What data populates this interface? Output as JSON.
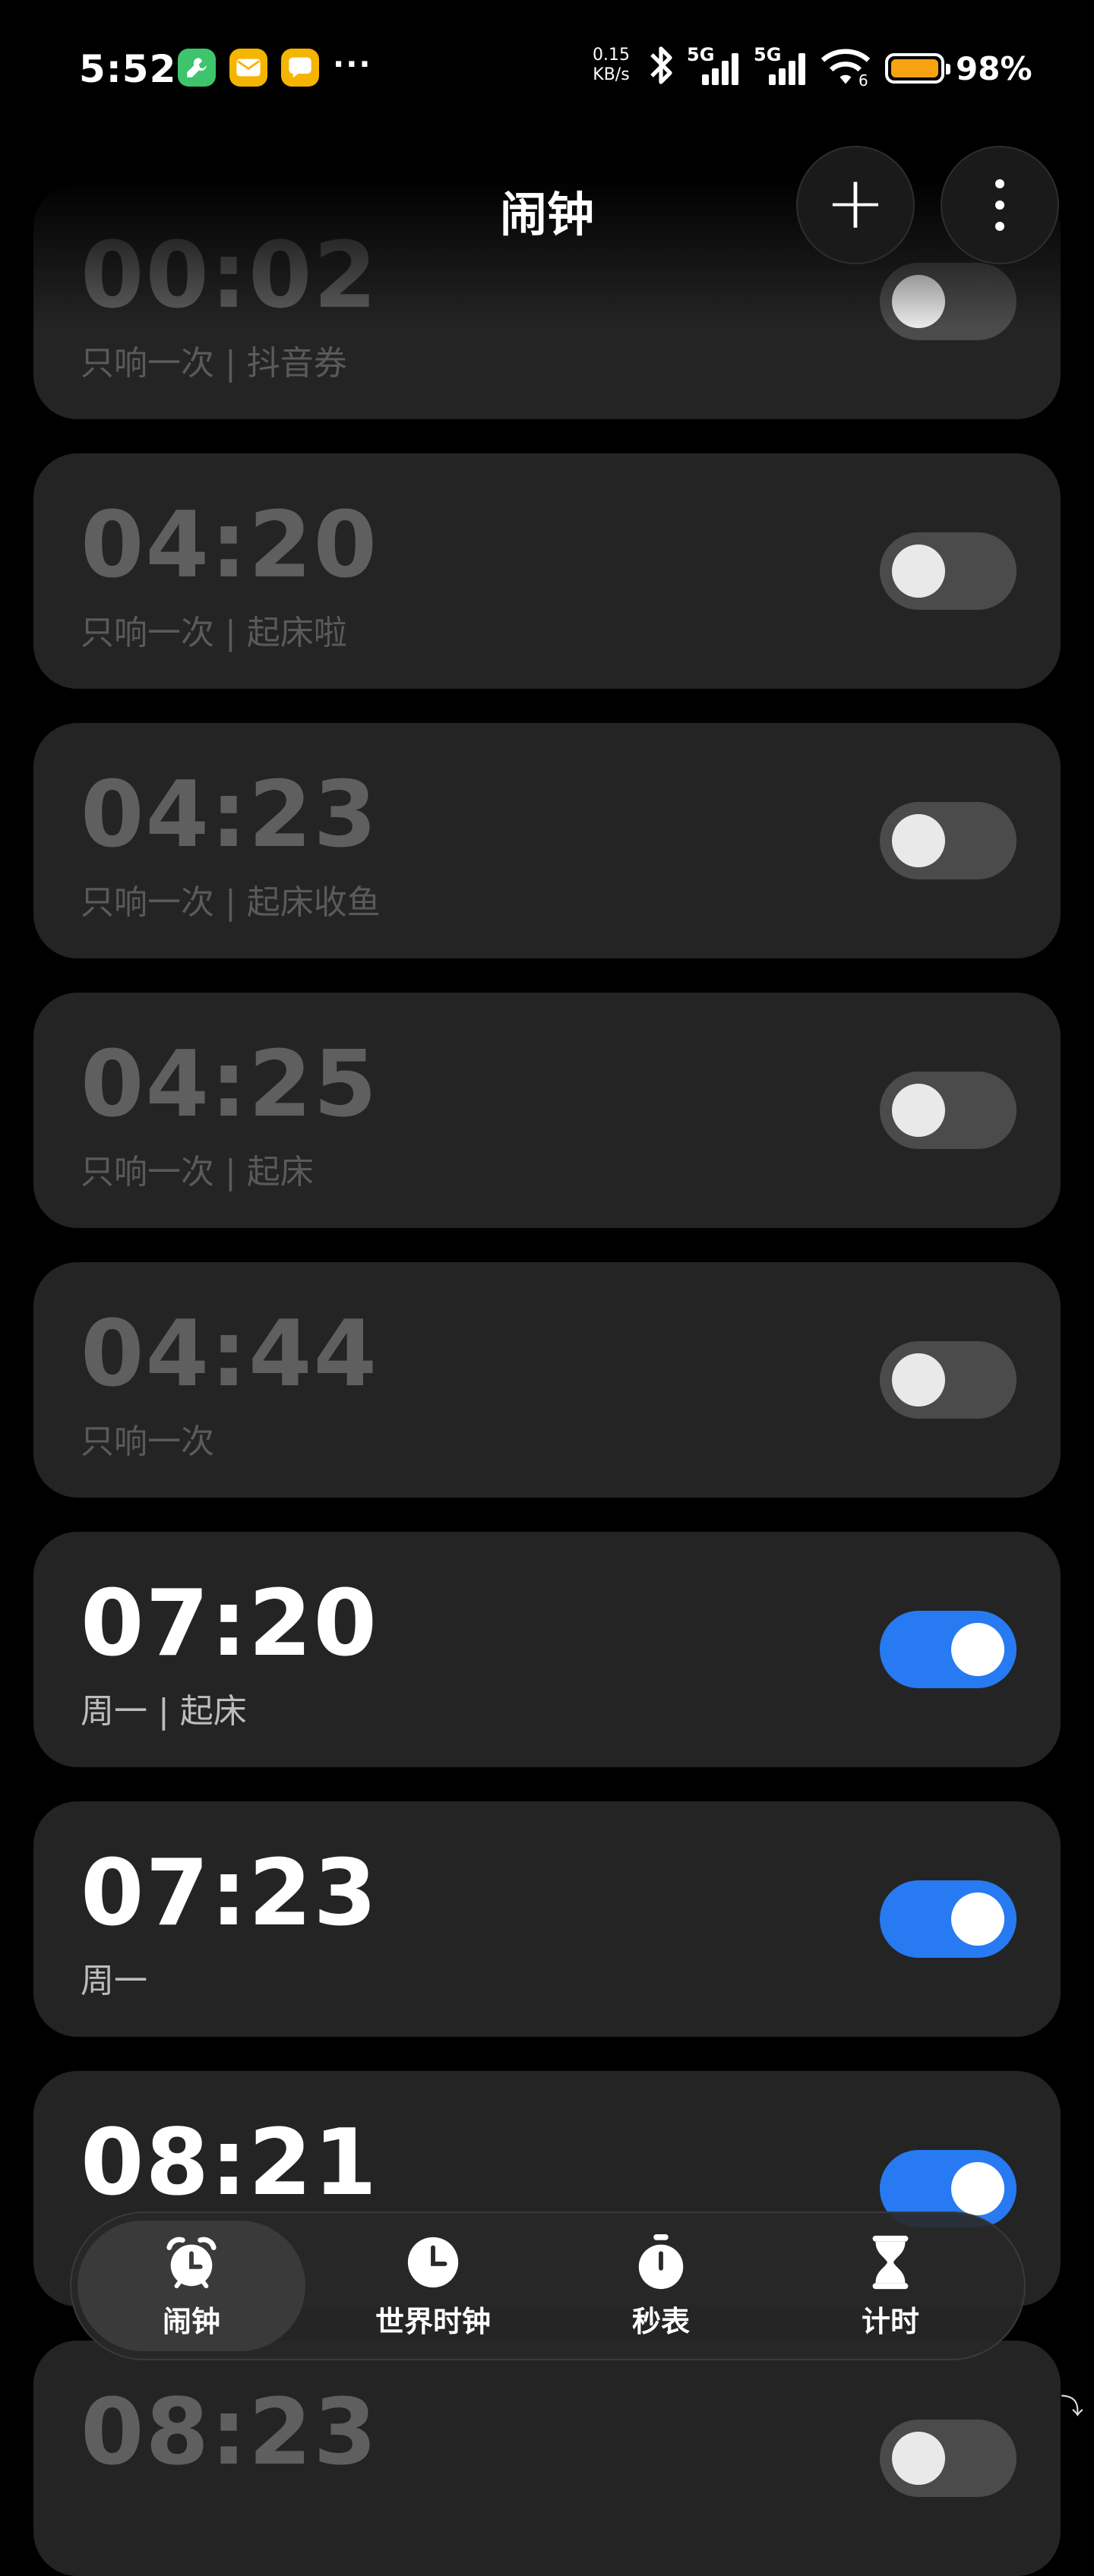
{
  "status_bar": {
    "time": "5:52",
    "net_speed": "0.15",
    "net_unit": "KB/s",
    "sim1": "5G",
    "sim2": "5G",
    "wifi_sub": "6",
    "battery": "98%",
    "more": "···"
  },
  "header": {
    "title": "闹钟",
    "add_label": "+"
  },
  "alarms": [
    {
      "time": "00:02",
      "desc": "只响一次 | 抖音券",
      "enabled": false
    },
    {
      "time": "04:20",
      "desc": "只响一次 | 起床啦",
      "enabled": false
    },
    {
      "time": "04:23",
      "desc": "只响一次 | 起床收鱼",
      "enabled": false
    },
    {
      "time": "04:25",
      "desc": "只响一次 | 起床",
      "enabled": false
    },
    {
      "time": "04:44",
      "desc": "只响一次",
      "enabled": false
    },
    {
      "time": "07:20",
      "desc": "周一 | 起床",
      "enabled": true
    },
    {
      "time": "07:23",
      "desc": "周一",
      "enabled": true
    },
    {
      "time": "08:21",
      "desc": "",
      "enabled": true
    },
    {
      "time": "08:23",
      "desc": "",
      "enabled": false
    }
  ],
  "tabs": [
    {
      "label": "闹钟",
      "icon": "alarm-clock-icon",
      "active": true
    },
    {
      "label": "世界时钟",
      "icon": "clock-icon",
      "active": false
    },
    {
      "label": "秒表",
      "icon": "stopwatch-icon",
      "active": false
    },
    {
      "label": "计时",
      "icon": "hourglass-icon",
      "active": false
    }
  ],
  "colors": {
    "accent": "#277af2",
    "card": "#242424",
    "battery": "#f7a212"
  }
}
